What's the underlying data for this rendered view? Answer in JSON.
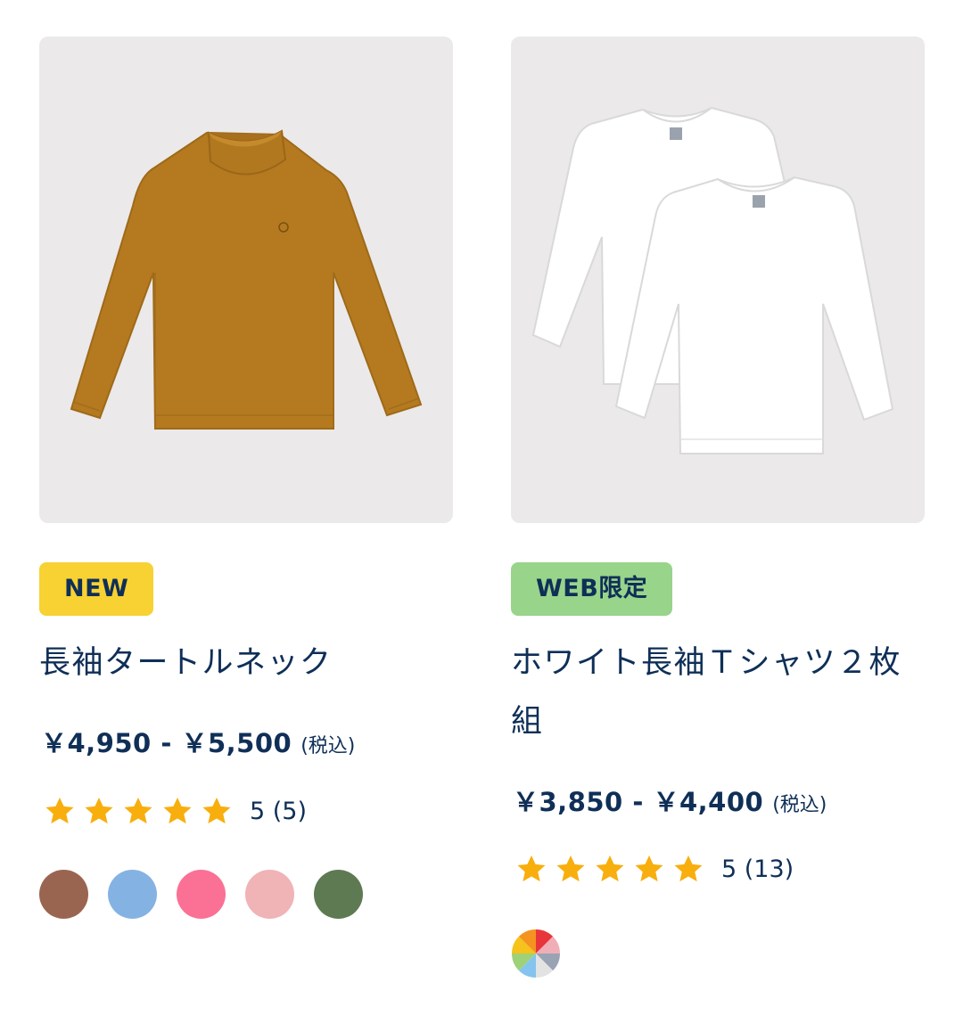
{
  "products": [
    {
      "badge": "NEW",
      "name": "長袖タートルネック",
      "price": "￥4,950 - ￥5,500",
      "tax_note": "(税込)",
      "rating_text": "5 (5)",
      "image_icon": "turtleneck-shirt",
      "swatches": [
        {
          "name": "brown",
          "color": "#9a6550"
        },
        {
          "name": "light-blue",
          "color": "#84b3e3"
        },
        {
          "name": "pink",
          "color": "#fa7195"
        },
        {
          "name": "light-pink",
          "color": "#f0b3b6"
        },
        {
          "name": "green",
          "color": "#5e7a52"
        }
      ]
    },
    {
      "badge": "WEB限定",
      "name": "ホワイト長袖Ｔシャツ２枚組",
      "price": "￥3,850 - ￥4,400",
      "tax_note": "(税込)",
      "rating_text": "5 (13)",
      "image_icon": "white-tshirts",
      "swatches": [
        {
          "name": "multicolor",
          "color": "multi"
        }
      ]
    }
  ],
  "colors": {
    "text": "#0f2f57",
    "star": "#f8ae0c",
    "badge_new": "#f8d133",
    "badge_web": "#98d48a",
    "image_bg": "#ebe9ea"
  }
}
